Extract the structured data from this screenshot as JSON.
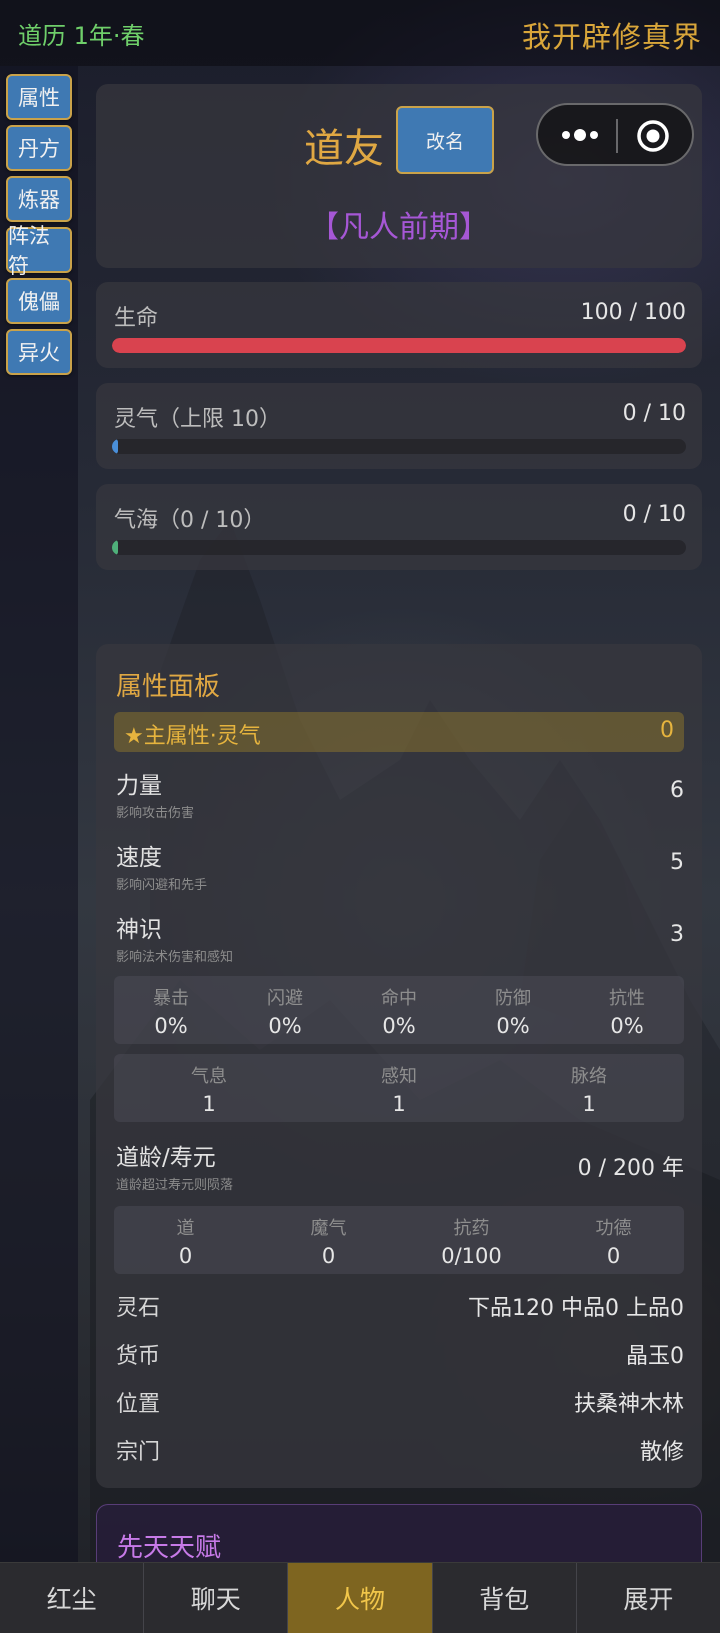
{
  "header": {
    "calendar": "道历 1年·春",
    "title": "我开辟修真界"
  },
  "side_menu": [
    "属性",
    "丹方",
    "炼器",
    "阵法符",
    "傀儡",
    "异火"
  ],
  "profile": {
    "name": "道友",
    "rename_label": "改名",
    "realm": "【凡人前期】"
  },
  "stats": [
    {
      "label": "生命",
      "value": "100 / 100",
      "fill": 1.0,
      "color": "#d9434f"
    },
    {
      "label": "灵气（上限 10）",
      "value": "0 / 10",
      "fill": 0.0,
      "color": "#4a8fd9"
    },
    {
      "label": "气海（0 / 10）",
      "value": "0 / 10",
      "fill": 0.0,
      "color": "#4fb07a"
    }
  ],
  "attr_panel": {
    "title": "属性面板",
    "main_attr": {
      "label": "★主属性·灵气",
      "value": "0"
    },
    "attributes": [
      {
        "name": "力量",
        "desc": "影响攻击伤害",
        "value": "6"
      },
      {
        "name": "速度",
        "desc": "影响闪避和先手",
        "value": "5"
      },
      {
        "name": "神识",
        "desc": "影响法术伤害和感知",
        "value": "3"
      }
    ],
    "combat_stats": [
      {
        "k": "暴击",
        "v": "0%"
      },
      {
        "k": "闪避",
        "v": "0%"
      },
      {
        "k": "命中",
        "v": "0%"
      },
      {
        "k": "防御",
        "v": "0%"
      },
      {
        "k": "抗性",
        "v": "0%"
      }
    ],
    "sub_stats": [
      {
        "k": "气息",
        "v": "1"
      },
      {
        "k": "感知",
        "v": "1"
      },
      {
        "k": "脉络",
        "v": "1"
      }
    ],
    "lifespan": {
      "name": "道龄/寿元",
      "desc": "道龄超过寿元则陨落",
      "value": "0 / 200 年"
    },
    "karma_stats": [
      {
        "k": "道",
        "v": "0"
      },
      {
        "k": "魔气",
        "v": "0"
      },
      {
        "k": "抗药",
        "v": "0/100"
      },
      {
        "k": "功德",
        "v": "0"
      }
    ],
    "info": [
      {
        "k": "灵石",
        "v": "下品120  中品0  上品0"
      },
      {
        "k": "货币",
        "v": "晶玉0"
      },
      {
        "k": "位置",
        "v": "扶桑神木林"
      },
      {
        "k": "宗门",
        "v": "散修"
      }
    ]
  },
  "talent": {
    "title": "先天天赋"
  },
  "bottom_nav": {
    "tabs": [
      "红尘",
      "聊天",
      "人物",
      "背包",
      "展开"
    ],
    "active": "人物"
  }
}
